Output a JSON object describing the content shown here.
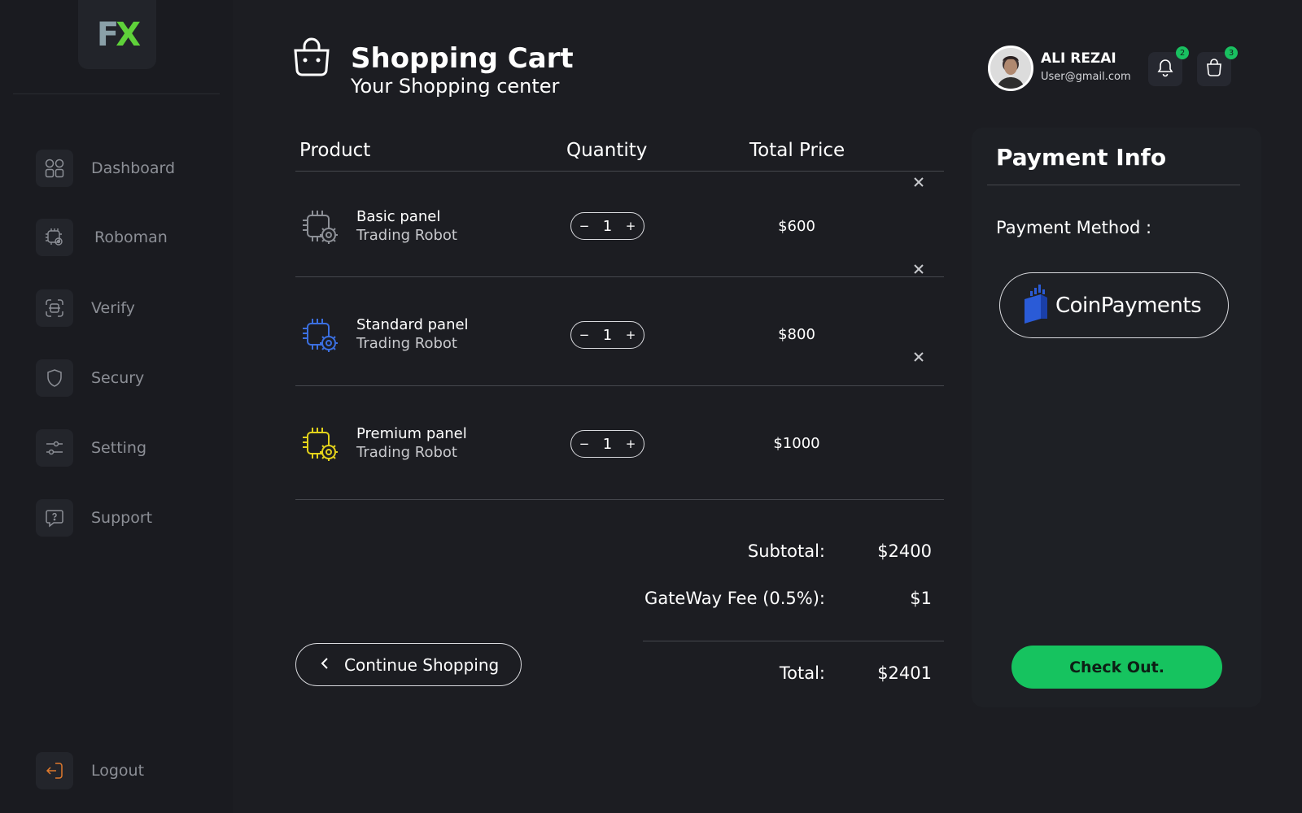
{
  "brand": {
    "logo_f": "F",
    "logo_x": "X"
  },
  "sidebar": {
    "items": [
      {
        "label": "Dashboard",
        "icon": "grid-icon"
      },
      {
        "label": "Roboman",
        "icon": "robot-chip-icon"
      },
      {
        "label": "Verify",
        "icon": "scan-icon"
      },
      {
        "label": "Secury",
        "icon": "shield-icon"
      },
      {
        "label": "Setting",
        "icon": "sliders-icon"
      },
      {
        "label": "Support",
        "icon": "help-chat-icon"
      }
    ],
    "logout": {
      "label": "Logout",
      "icon": "logout-icon"
    }
  },
  "header": {
    "title": "Shopping Cart",
    "subtitle": "Your Shopping center",
    "user": {
      "name": "ALI REZAI",
      "email": "User@gmail.com"
    },
    "notifications_count": "2",
    "cart_count": "3"
  },
  "table": {
    "headers": {
      "product": "Product",
      "quantity": "Quantity",
      "total_price": "Total Price"
    },
    "rows": [
      {
        "name": "Basic panel",
        "sub": "Trading Robot",
        "qty": "1",
        "price": "$600",
        "icon_color": "#8c8f96"
      },
      {
        "name": "Standard panel",
        "sub": "Trading Robot",
        "qty": "1",
        "price": "$800",
        "icon_color": "#3b6fe0"
      },
      {
        "name": "Premium panel",
        "sub": "Trading Robot",
        "qty": "1",
        "price": "$1000",
        "icon_color": "#e3d21b"
      }
    ],
    "qty_minus": "−",
    "qty_plus": "+"
  },
  "totals": {
    "subtotal_label": "Subtotal:",
    "subtotal_value": "$2400",
    "fee_label": "GateWay Fee (0.5%):",
    "fee_value": "$1",
    "total_label": "Total:",
    "total_value": "$2401"
  },
  "continue_label": "Continue Shopping",
  "payment": {
    "title": "Payment Info",
    "method_label": "Payment Method :",
    "method_name": "CoinPayments",
    "checkout_label": "Check Out."
  },
  "colors": {
    "accent_green": "#16c35f",
    "background": "#1c1d22",
    "sidebar": "#1a1b20"
  }
}
